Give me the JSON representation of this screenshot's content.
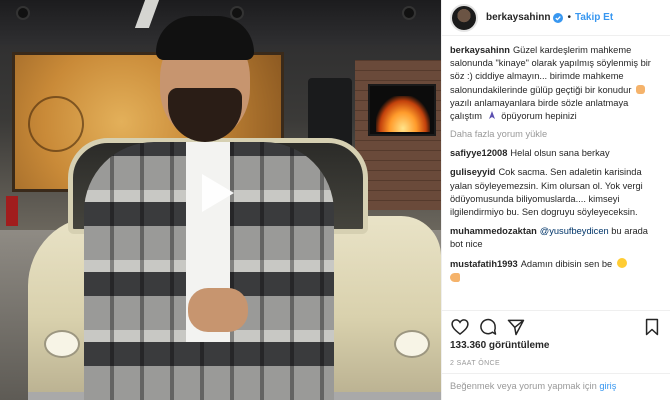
{
  "header": {
    "username": "berkaysahinn",
    "separator": "•",
    "follow_label": "Takip Et"
  },
  "caption": {
    "username": "berkaysahinn",
    "text_1": "Güzel kardeşlerim mahkeme salonunda \"kinaye\" olarak yapılmış söylenmiş bir söz :) ciddiye almayın... birimde mahkeme salonundakilerinde gülüp geçtiği bir konudur",
    "text_2": "yazılı anlamayanlara birde sözle anlatmaya çalıştım",
    "text_3": "öpüyorum hepinizi"
  },
  "more_comments_label": "Daha fazla yorum yükle",
  "comments": [
    {
      "username": "safiyye12008",
      "text": "Helal olsun sana berkay"
    },
    {
      "username": "guliseyyid",
      "text": "Cok sacma. Sen adaletin karisinda yalan söyleyemezsin. Kim olursan ol. Yok vergi ödüyomusunda biliyomuslarda.... kimseyi ilgilendirmiyo bu. Sen dogruyu söyleyeceksin."
    },
    {
      "username": "muhammedozaktan",
      "mention": "@yusufbeydicen",
      "text": "bu arada bot nice"
    },
    {
      "username": "mustafatih1993",
      "text": "Adamın dibisin sen be"
    }
  ],
  "stats": {
    "views": "133.360 görüntüleme",
    "time": "2 SAAT ÖNCE"
  },
  "login": {
    "text": "Beğenmek veya yorum yapmak için",
    "link": "giriş"
  },
  "icons": {
    "play": "play-icon",
    "like": "heart-icon",
    "comment": "comment-icon",
    "share": "share-icon",
    "save": "bookmark-icon",
    "verified": "verified-badge-icon"
  },
  "colors": {
    "link_blue": "#3897f0",
    "text": "#262626",
    "muted": "#999999",
    "mention": "#003569"
  }
}
